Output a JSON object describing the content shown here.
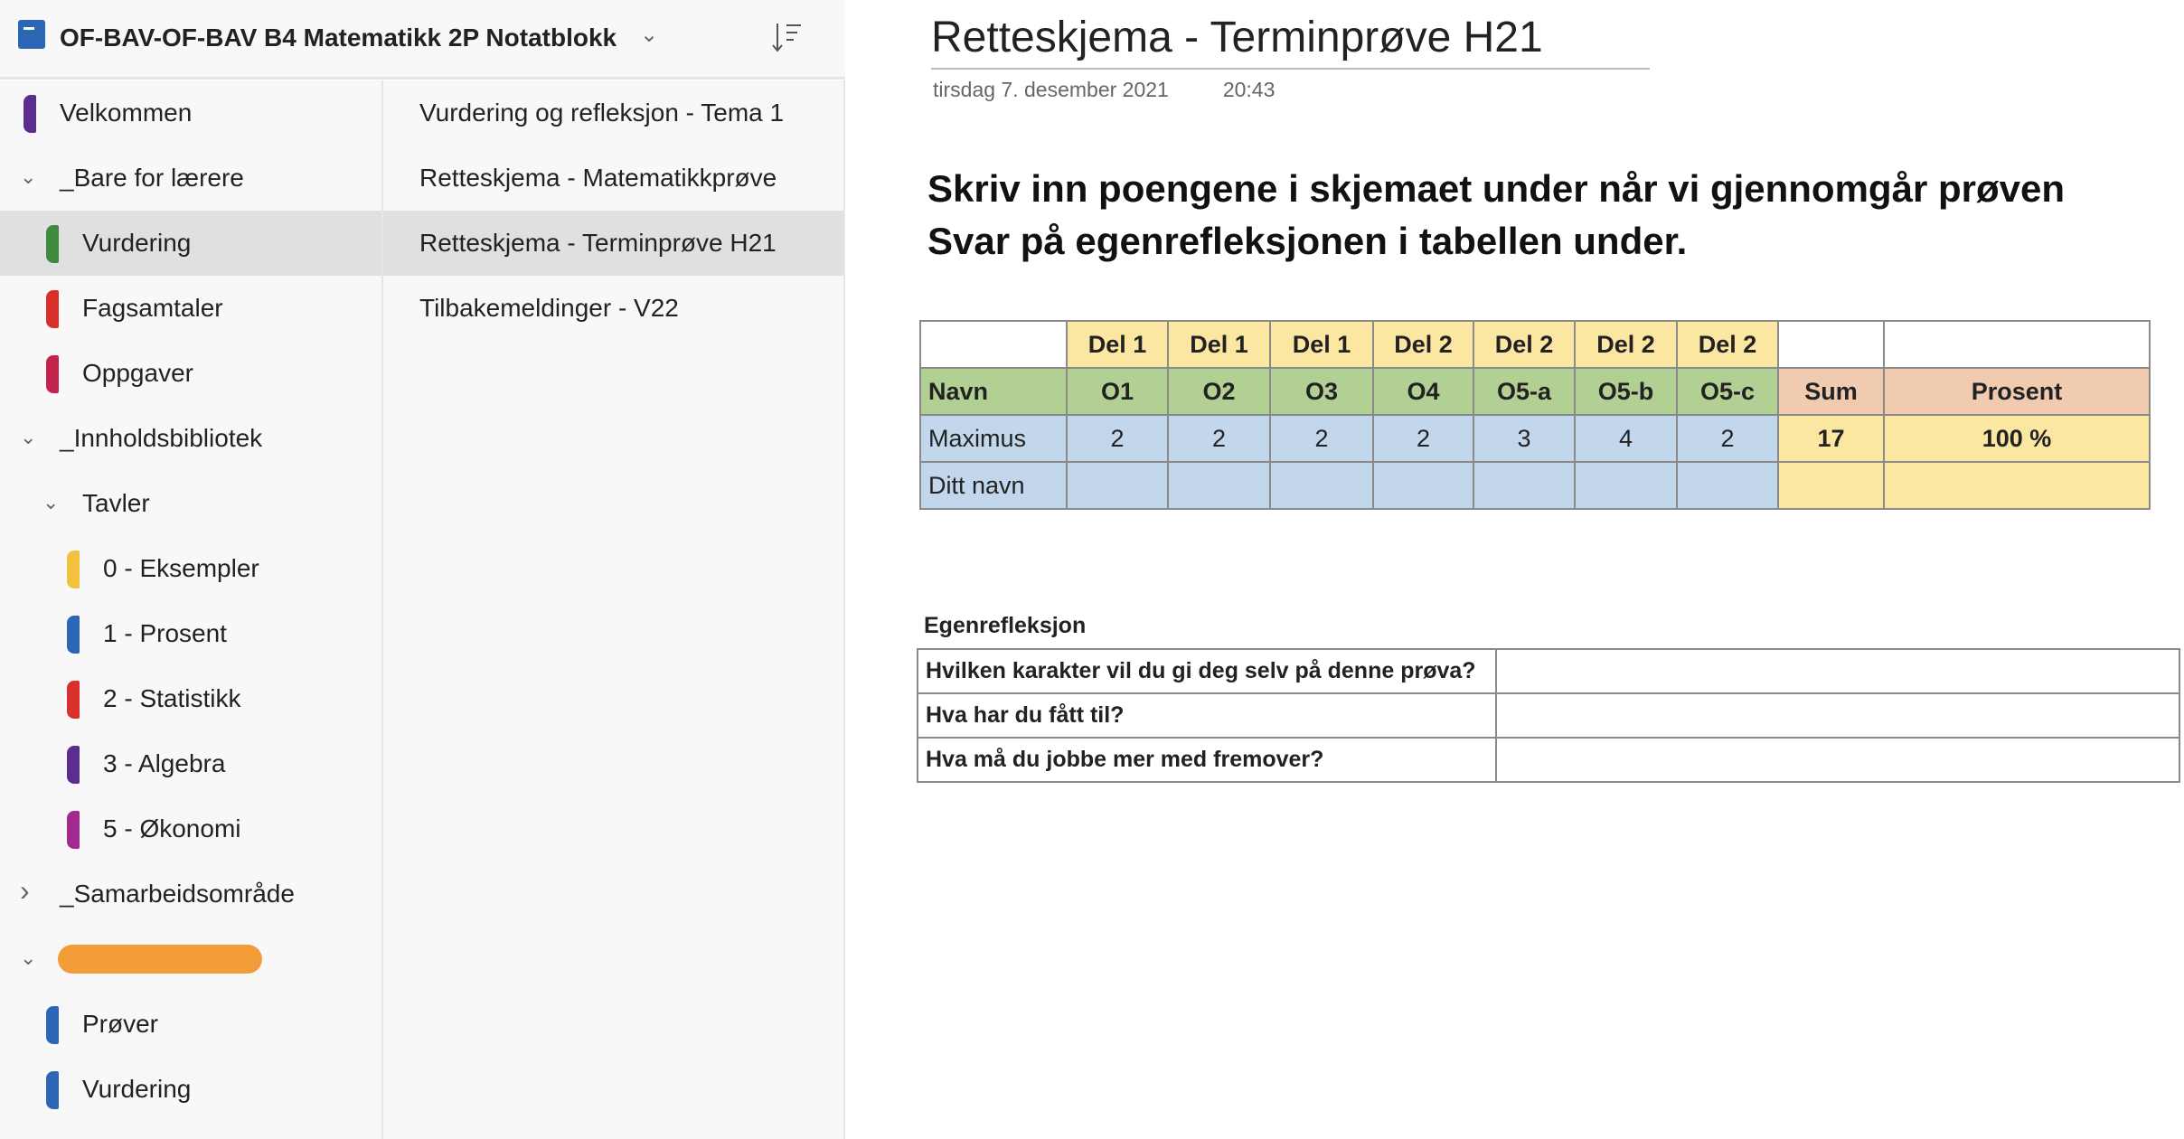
{
  "notebook": {
    "title": "OF-BAV-OF-BAV B4 Matematikk 2P Notatblokk"
  },
  "sections": [
    {
      "label": "Velkommen",
      "color": "#5b2d91",
      "level": 0
    },
    {
      "label": "_Bare for lærere",
      "group": true,
      "expanded": true,
      "level": 0
    },
    {
      "label": "Vurdering",
      "color": "#3e8a41",
      "level": 1,
      "selected": true
    },
    {
      "label": "Fagsamtaler",
      "color": "#d9302c",
      "level": 1
    },
    {
      "label": "Oppgaver",
      "color": "#c4244c",
      "level": 1
    },
    {
      "label": "_Innholdsbibliotek",
      "group": true,
      "expanded": true,
      "level": 0
    },
    {
      "label": "Tavler",
      "group": true,
      "expanded": true,
      "level": 1
    },
    {
      "label": "0 - Eksempler",
      "color": "#f2c13d",
      "level": 2
    },
    {
      "label": "1 - Prosent",
      "color": "#2b67b5",
      "level": 2
    },
    {
      "label": "2 - Statistikk",
      "color": "#d9302c",
      "level": 2
    },
    {
      "label": "3 - Algebra",
      "color": "#5b2d91",
      "level": 2
    },
    {
      "label": "5 - Økonomi",
      "color": "#a12a8e",
      "level": 2
    },
    {
      "label": "_Samarbeidsområde",
      "group": true,
      "expanded": false,
      "level": 0
    },
    {
      "label": "",
      "group": true,
      "expanded": true,
      "level": 0,
      "redacted": true
    },
    {
      "label": "Prøver",
      "color": "#2b67b5",
      "level": 1
    },
    {
      "label": "Vurdering",
      "color": "#2b67b5",
      "level": 1
    }
  ],
  "pages": [
    {
      "label": "Vurdering og refleksjon - Tema 1"
    },
    {
      "label": "Retteskjema - Matematikkprøve"
    },
    {
      "label": "Retteskjema - Terminprøve H21",
      "selected": true
    },
    {
      "label": "Tilbakemeldinger - V22"
    }
  ],
  "page": {
    "title": "Retteskjema - Terminprøve H21",
    "date": "tirsdag 7. desember 2021",
    "time": "20:43",
    "instructions": [
      "Skriv inn poengene i skjemaet under når vi gjennomgår prøven",
      "Svar på egenrefleksjonen i tabellen under."
    ],
    "score_table": {
      "parts": [
        "",
        "Del 1",
        "Del 1",
        "Del 1",
        "Del 2",
        "Del 2",
        "Del 2",
        "Del 2",
        "",
        ""
      ],
      "header": [
        "Navn",
        "O1",
        "O2",
        "O3",
        "O4",
        "O5-a",
        "O5-b",
        "O5-c",
        "Sum",
        "Prosent"
      ],
      "rows": [
        [
          "Maximus",
          "2",
          "2",
          "2",
          "2",
          "3",
          "4",
          "2",
          "17",
          "100 %"
        ],
        [
          "Ditt navn",
          "",
          "",
          "",
          "",
          "",
          "",
          "",
          "",
          ""
        ]
      ]
    },
    "reflection": {
      "title": "Egenrefleksjon",
      "questions": [
        "Hvilken karakter vil du gi deg selv på denne prøva?",
        "Hva har du fått til?",
        "Hva må du jobbe mer med fremover?"
      ]
    }
  }
}
